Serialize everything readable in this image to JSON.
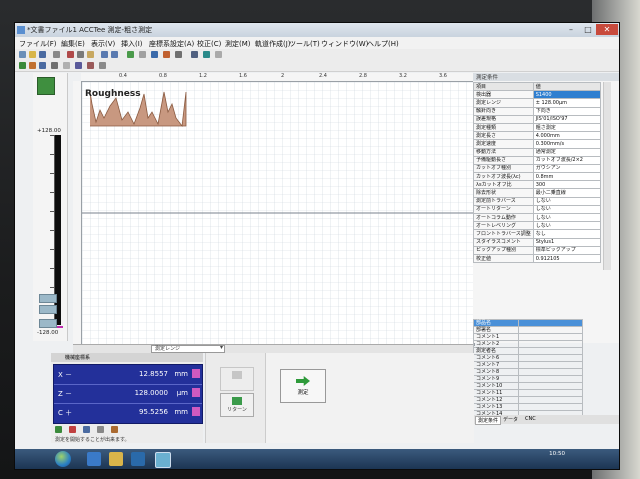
{
  "window": {
    "title": "*文書ファイル1 ACCTee 測定-粗さ測定",
    "controls": {
      "minimize": "–",
      "maximize": "□",
      "close": "✕"
    }
  },
  "menu": [
    "ファイル(F)",
    "編集(E)",
    "表示(V)",
    "挿入(I)",
    "座標系設定(A)",
    "校正(C)",
    "測定(M)",
    "軌道作成(J)",
    "ツール(T)",
    "ウィンドウ(W)",
    "ヘルプ(H)"
  ],
  "meter": {
    "top_label": "+128.00",
    "bottom_label": "-128.00"
  },
  "graph": {
    "title": "Roughness",
    "top_ticks": [
      "0.4",
      "0.8",
      "1.2",
      "1.6",
      "2",
      "2.4",
      "2.8",
      "3.2",
      "3.6"
    ],
    "range_label": "測定レンジ"
  },
  "params": {
    "header": "測定条件",
    "col_item": "項目",
    "col_value": "値",
    "rows": [
      {
        "k": "検出器",
        "v": "S1400"
      },
      {
        "k": "測定レンジ",
        "v": "± 128.00μm"
      },
      {
        "k": "触針向き",
        "v": "下向き"
      },
      {
        "k": "誤差規格",
        "v": "JIS'01/ISO'97"
      },
      {
        "k": "測定種類",
        "v": "粗さ測定"
      },
      {
        "k": "測定長さ",
        "v": "4.000mm"
      },
      {
        "k": "測定速度",
        "v": "0.300mm/s"
      },
      {
        "k": "移動方法",
        "v": "通常測定"
      },
      {
        "k": "予備駆動長さ",
        "v": "カットオフ波長/2×2"
      },
      {
        "k": "カットオフ種別",
        "v": "ガウシアン"
      },
      {
        "k": "カットオフ波長(λc)",
        "v": "0.8mm"
      },
      {
        "k": "λsカットオフ比",
        "v": "300"
      },
      {
        "k": "除去形状",
        "v": "最小二乗直線"
      },
      {
        "k": "測定前トラバース",
        "v": "しない"
      },
      {
        "k": "オートリターン",
        "v": "しない"
      },
      {
        "k": "オートコラム動作",
        "v": "しない"
      },
      {
        "k": "オートレベリング",
        "v": "しない"
      },
      {
        "k": "フロントトラバース調整",
        "v": "なし"
      },
      {
        "k": "スタイラスコメント",
        "v": "Stylus1"
      },
      {
        "k": "ピックアップ種別",
        "v": "標準ピックアップ"
      },
      {
        "k": "校正値",
        "v": "0.912105"
      }
    ]
  },
  "comments": {
    "header": "部品名",
    "rows": [
      "部署名",
      "コメント1",
      "コメント2",
      "測定者名",
      "コメント6",
      "コメント7",
      "コメント8",
      "コメント9",
      "コメント10",
      "コメント11",
      "コメント12",
      "コメント13",
      "コメント14"
    ]
  },
  "readout": {
    "header": "機械座標系",
    "rows": [
      {
        "axis": "X",
        "sign": "－",
        "value": "12.8557",
        "unit": "mm"
      },
      {
        "axis": "Z",
        "sign": "－",
        "value": "128.0000",
        "unit": "μm"
      },
      {
        "axis": "C",
        "sign": "＋",
        "value": "95.5256",
        "unit": "mm"
      }
    ],
    "status": "測定を開始することが出来ます。"
  },
  "controls": {
    "return_label": "リターン",
    "measure_label": "測定"
  },
  "tabs": [
    "測定条件",
    "データ",
    "CNC"
  ],
  "clock": {
    "time": "10:50"
  },
  "colors": {
    "readout_bg": "#23309a",
    "highlight": "#2f7fd0",
    "marker": "#d05ac0",
    "measure_arrow": "#2e9a3a"
  }
}
